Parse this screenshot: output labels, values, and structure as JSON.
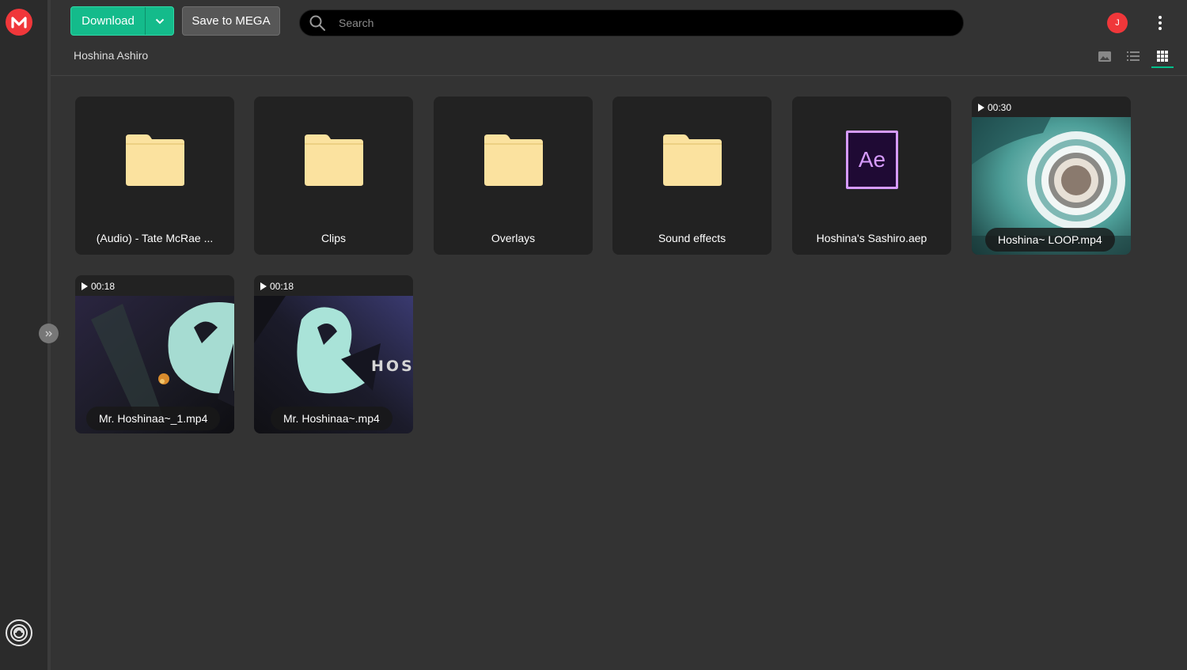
{
  "toolbar": {
    "download_label": "Download",
    "save_label": "Save to MEGA"
  },
  "search": {
    "placeholder": "Search",
    "value": ""
  },
  "user": {
    "avatar_initial": "J"
  },
  "breadcrumb": "Hoshina Ashiro",
  "colors": {
    "accent": "#14bb8b",
    "brand": "#f0373a",
    "folder": "#fbe29f",
    "ae_purple": "#d69bfd"
  },
  "icons": {
    "logo": "mega-logo-icon",
    "search": "search-icon",
    "menu": "more-vertical-icon",
    "views": [
      "thumbnail-view-icon",
      "list-view-icon",
      "grid-view-icon"
    ]
  },
  "items": [
    {
      "type": "folder",
      "name": "(Audio) - Tate McRae ..."
    },
    {
      "type": "folder",
      "name": "Clips"
    },
    {
      "type": "folder",
      "name": "Overlays"
    },
    {
      "type": "folder",
      "name": "Sound effects"
    },
    {
      "type": "file",
      "icon": "after-effects-icon",
      "icon_text": "Ae",
      "name": "Hoshina's Sashiro.aep"
    },
    {
      "type": "video",
      "duration": "00:30",
      "name": "Hoshina~ LOOP.mp4"
    },
    {
      "type": "video",
      "duration": "00:18",
      "name": "Mr. Hoshinaa~_1.mp4"
    },
    {
      "type": "video",
      "duration": "00:18",
      "name": "Mr. Hoshinaa~.mp4",
      "overlay_text": "HOSI"
    }
  ]
}
